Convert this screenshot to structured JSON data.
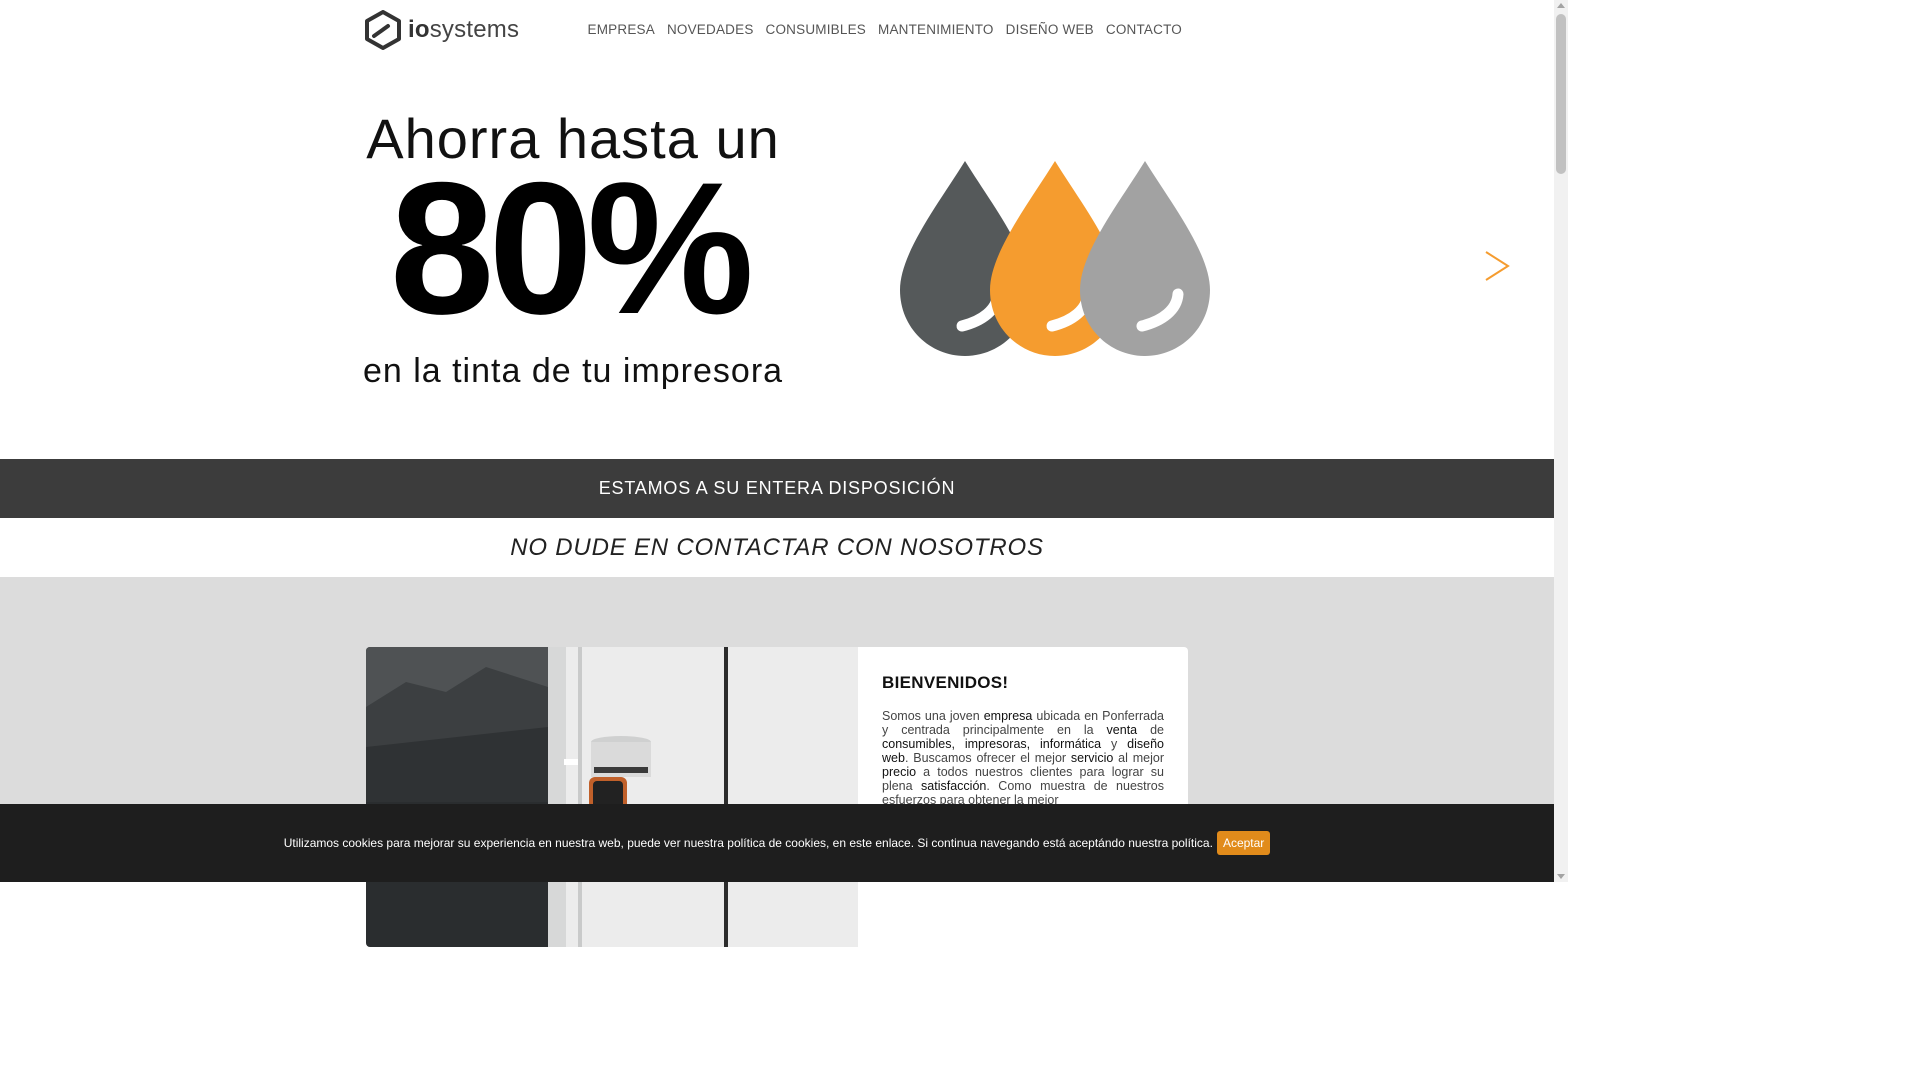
{
  "brand": {
    "prefix": "io",
    "suffix": "systems"
  },
  "nav": [
    {
      "label": "EMPRESA"
    },
    {
      "label": "NOVEDADES"
    },
    {
      "label": "CONSUMIBLES"
    },
    {
      "label": "MANTENIMIENTO"
    },
    {
      "label": "DISEÑO WEB"
    },
    {
      "label": "CONTACTO"
    }
  ],
  "hero": {
    "line1": "Ahorra hasta un",
    "big": "80%",
    "line3": "en la tinta de tu impresora",
    "drop_colors": [
      "#55595a",
      "#f59c2f",
      "#a2a2a2"
    ],
    "next_icon": "chevron-right-icon",
    "accent": "#f59c2f"
  },
  "banner": {
    "dark_text": "ESTAMOS A SU ENTERA DISPOSICIÓN",
    "light_text": "NO DUDE EN CONTACTAR CON NOSOTROS"
  },
  "welcome": {
    "title": "BIENVENIDOS!",
    "body_parts": [
      "Somos una joven ",
      "empresa",
      " ubicada en Ponferrada y centrada principalmente en la ",
      "venta",
      " de ",
      "consumibles, impresoras, informática",
      " y ",
      "diseño web",
      ". Buscamos ofrecer el mejor ",
      "servicio",
      " al mejor ",
      "precio",
      " a todos nuestros clientes para lograr su plena ",
      "satisfacción",
      ". Como muestra de nuestros esfuerzos para obtener la mejor"
    ]
  },
  "cookie": {
    "text": "Utilizamos cookies para mejorar su experiencia en nuestra web, puede ver nuestra política de cookies, en este enlace. Si continua navegando está aceptándo nuestra política.",
    "button": "Aceptar"
  }
}
